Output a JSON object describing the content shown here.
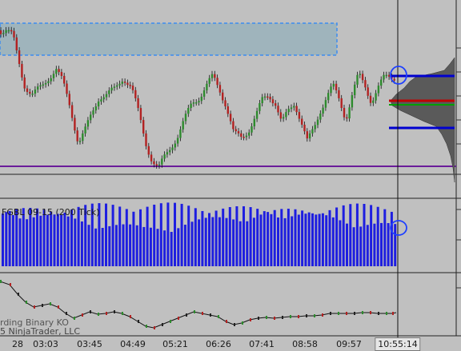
{
  "window": {
    "indicator_label": "FGBL 09-15 (200 Tick)",
    "copyright_line1": "rding Binary KO",
    "copyright_line2": "5 NinjaTrader, LLC",
    "current_time": "10:55:14"
  },
  "time_axis": {
    "ticks": [
      "28",
      "03:03",
      "03:45",
      "04:49",
      "05:21",
      "06:26",
      "07:41",
      "08:58",
      "09:57"
    ]
  },
  "colors": {
    "background": "#c0c0c0",
    "up_candle": "#2e8b2e",
    "down_candle": "#b22222",
    "volume_bars": "#1e1ee0",
    "zone_fill": "#9fb4bc",
    "zone_border": "#3c8cf0",
    "purple_line": "#6a1b9a",
    "blue_level": "#0000d0",
    "red_level": "#c00000",
    "green_level": "#00a000",
    "profile_fill": "#5a5a5a"
  },
  "icons": [
    "circle-marker-icon",
    "circle-marker-icon"
  ]
}
